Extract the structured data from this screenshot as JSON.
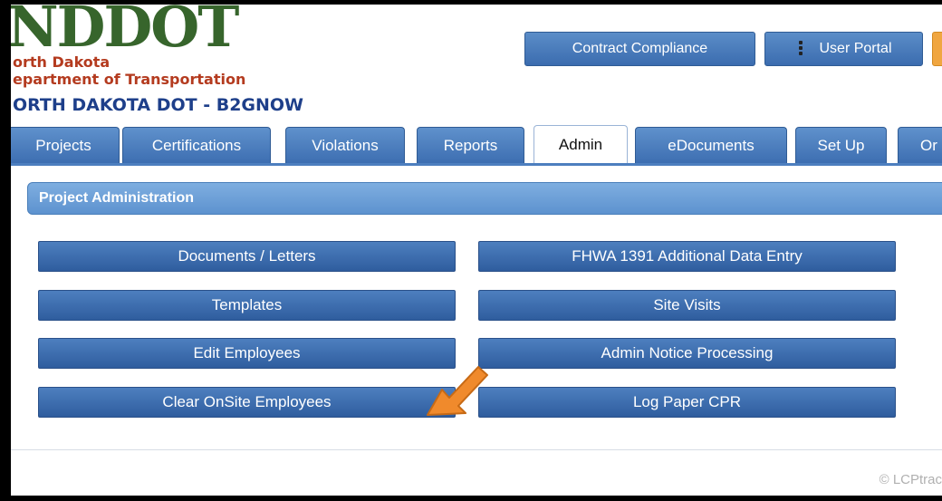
{
  "header": {
    "logo_text": "NDDOT",
    "logo_line1": "orth Dakota",
    "logo_line2": "epartment of Transportation",
    "site_title": "ORTH DAKOTA DOT - B2GNOW",
    "contract_compliance": "Contract Compliance",
    "user_portal": "User Portal",
    "user_portal_icon": "user-icon"
  },
  "tabs": [
    {
      "label": "Projects",
      "active": false
    },
    {
      "label": "Certifications",
      "active": false
    },
    {
      "label": "Violations",
      "active": false
    },
    {
      "label": "Reports",
      "active": false
    },
    {
      "label": "Admin",
      "active": true
    },
    {
      "label": "eDocuments",
      "active": false
    },
    {
      "label": "Set Up",
      "active": false
    },
    {
      "label": "Or",
      "active": false
    }
  ],
  "section": {
    "title": "Project Administration"
  },
  "buttons": {
    "documents_letters": "Documents / Letters",
    "templates": "Templates",
    "edit_employees": "Edit Employees",
    "clear_onsite": "Clear OnSite Employees",
    "fhwa_1391": "FHWA 1391 Additional Data Entry",
    "site_visits": "Site Visits",
    "admin_notice": "Admin Notice Processing",
    "log_paper_cpr": "Log Paper CPR"
  },
  "footer": {
    "copyright": "© LCPtrac"
  },
  "colors": {
    "accent_blue": "#3d6eb1",
    "arrow_orange": "#f08a2c",
    "logo_green": "#37652c",
    "logo_red": "#b43b1f"
  }
}
